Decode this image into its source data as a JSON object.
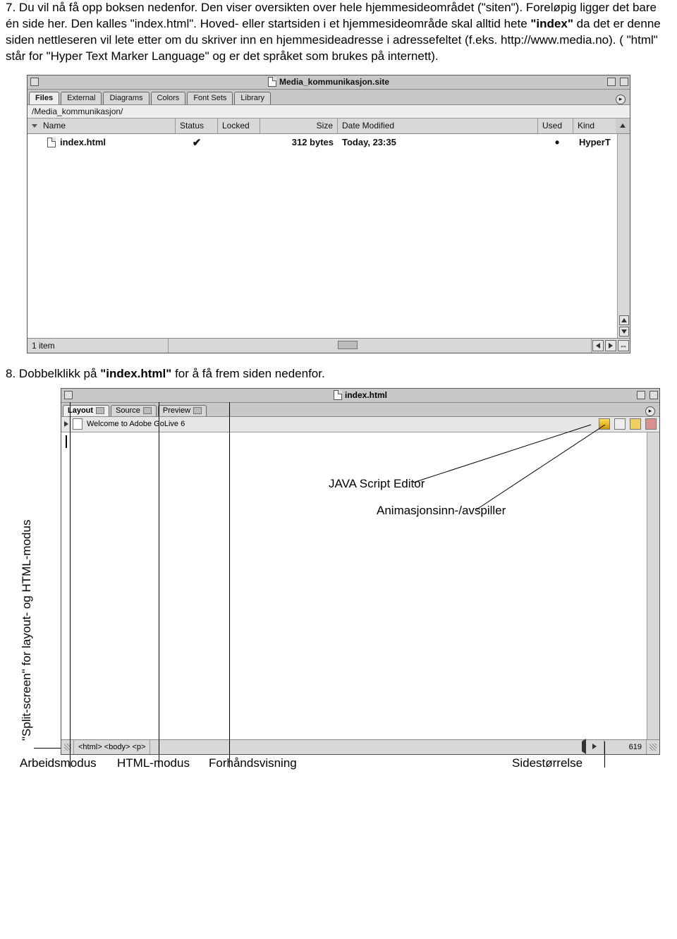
{
  "step7": {
    "num": "7.",
    "text_a": " Du vil nå få opp boksen nedenfor. Den viser oversikten over hele hjemmesideområdet (\"siten\"). Foreløpig ligger det bare én side her. Den kalles \"index.html\". Hoved- eller startsiden i et hjemmesideområde skal alltid hete ",
    "bold": "\"index\"",
    "text_b": " da det er denne siden nettleseren vil lete etter om du skriver inn en hjemmesideadresse i adressefeltet (f.eks. http://www.media.no). ( \"html\" står for \"Hyper Text Marker Language\" og er det språket som brukes på internett)."
  },
  "window1": {
    "title": "Media_kommunikasjon.site",
    "tabs": [
      "Files",
      "External",
      "Diagrams",
      "Colors",
      "Font Sets",
      "Library"
    ],
    "path": "/Media_kommunikasjon/",
    "columns": {
      "name": "Name",
      "status": "Status",
      "locked": "Locked",
      "size": "Size",
      "date": "Date Modified",
      "used": "Used",
      "kind": "Kind"
    },
    "row": {
      "name": "index.html",
      "status": "✔",
      "locked": "",
      "size": "312 bytes",
      "date": "Today, 23:35",
      "used": "•",
      "kind": "HyperT"
    },
    "status_count": "1 item"
  },
  "step8": {
    "num": "8.",
    "text_a": " Dobbelklikk på ",
    "bold": "\"index.html\"",
    "text_b": " for å få frem siden nedenfor."
  },
  "window2": {
    "title": "index.html",
    "tabs": [
      "Layout",
      "Source",
      "Preview"
    ],
    "welcome": "Welcome to Adobe GoLive 6",
    "crumbs": "<html> <body> <p>",
    "pagesize": "619"
  },
  "annotations": {
    "js_editor": "JAVA Script Editor",
    "anim": "Animasjonsinn-/avspiller",
    "split": "\"Split-screen\" for layout- og HTML-modus",
    "arbeid": "Arbeidsmodus",
    "html": "HTML-modus",
    "preview": "Forhåndsvisning",
    "size": "Sidestørrelse"
  }
}
